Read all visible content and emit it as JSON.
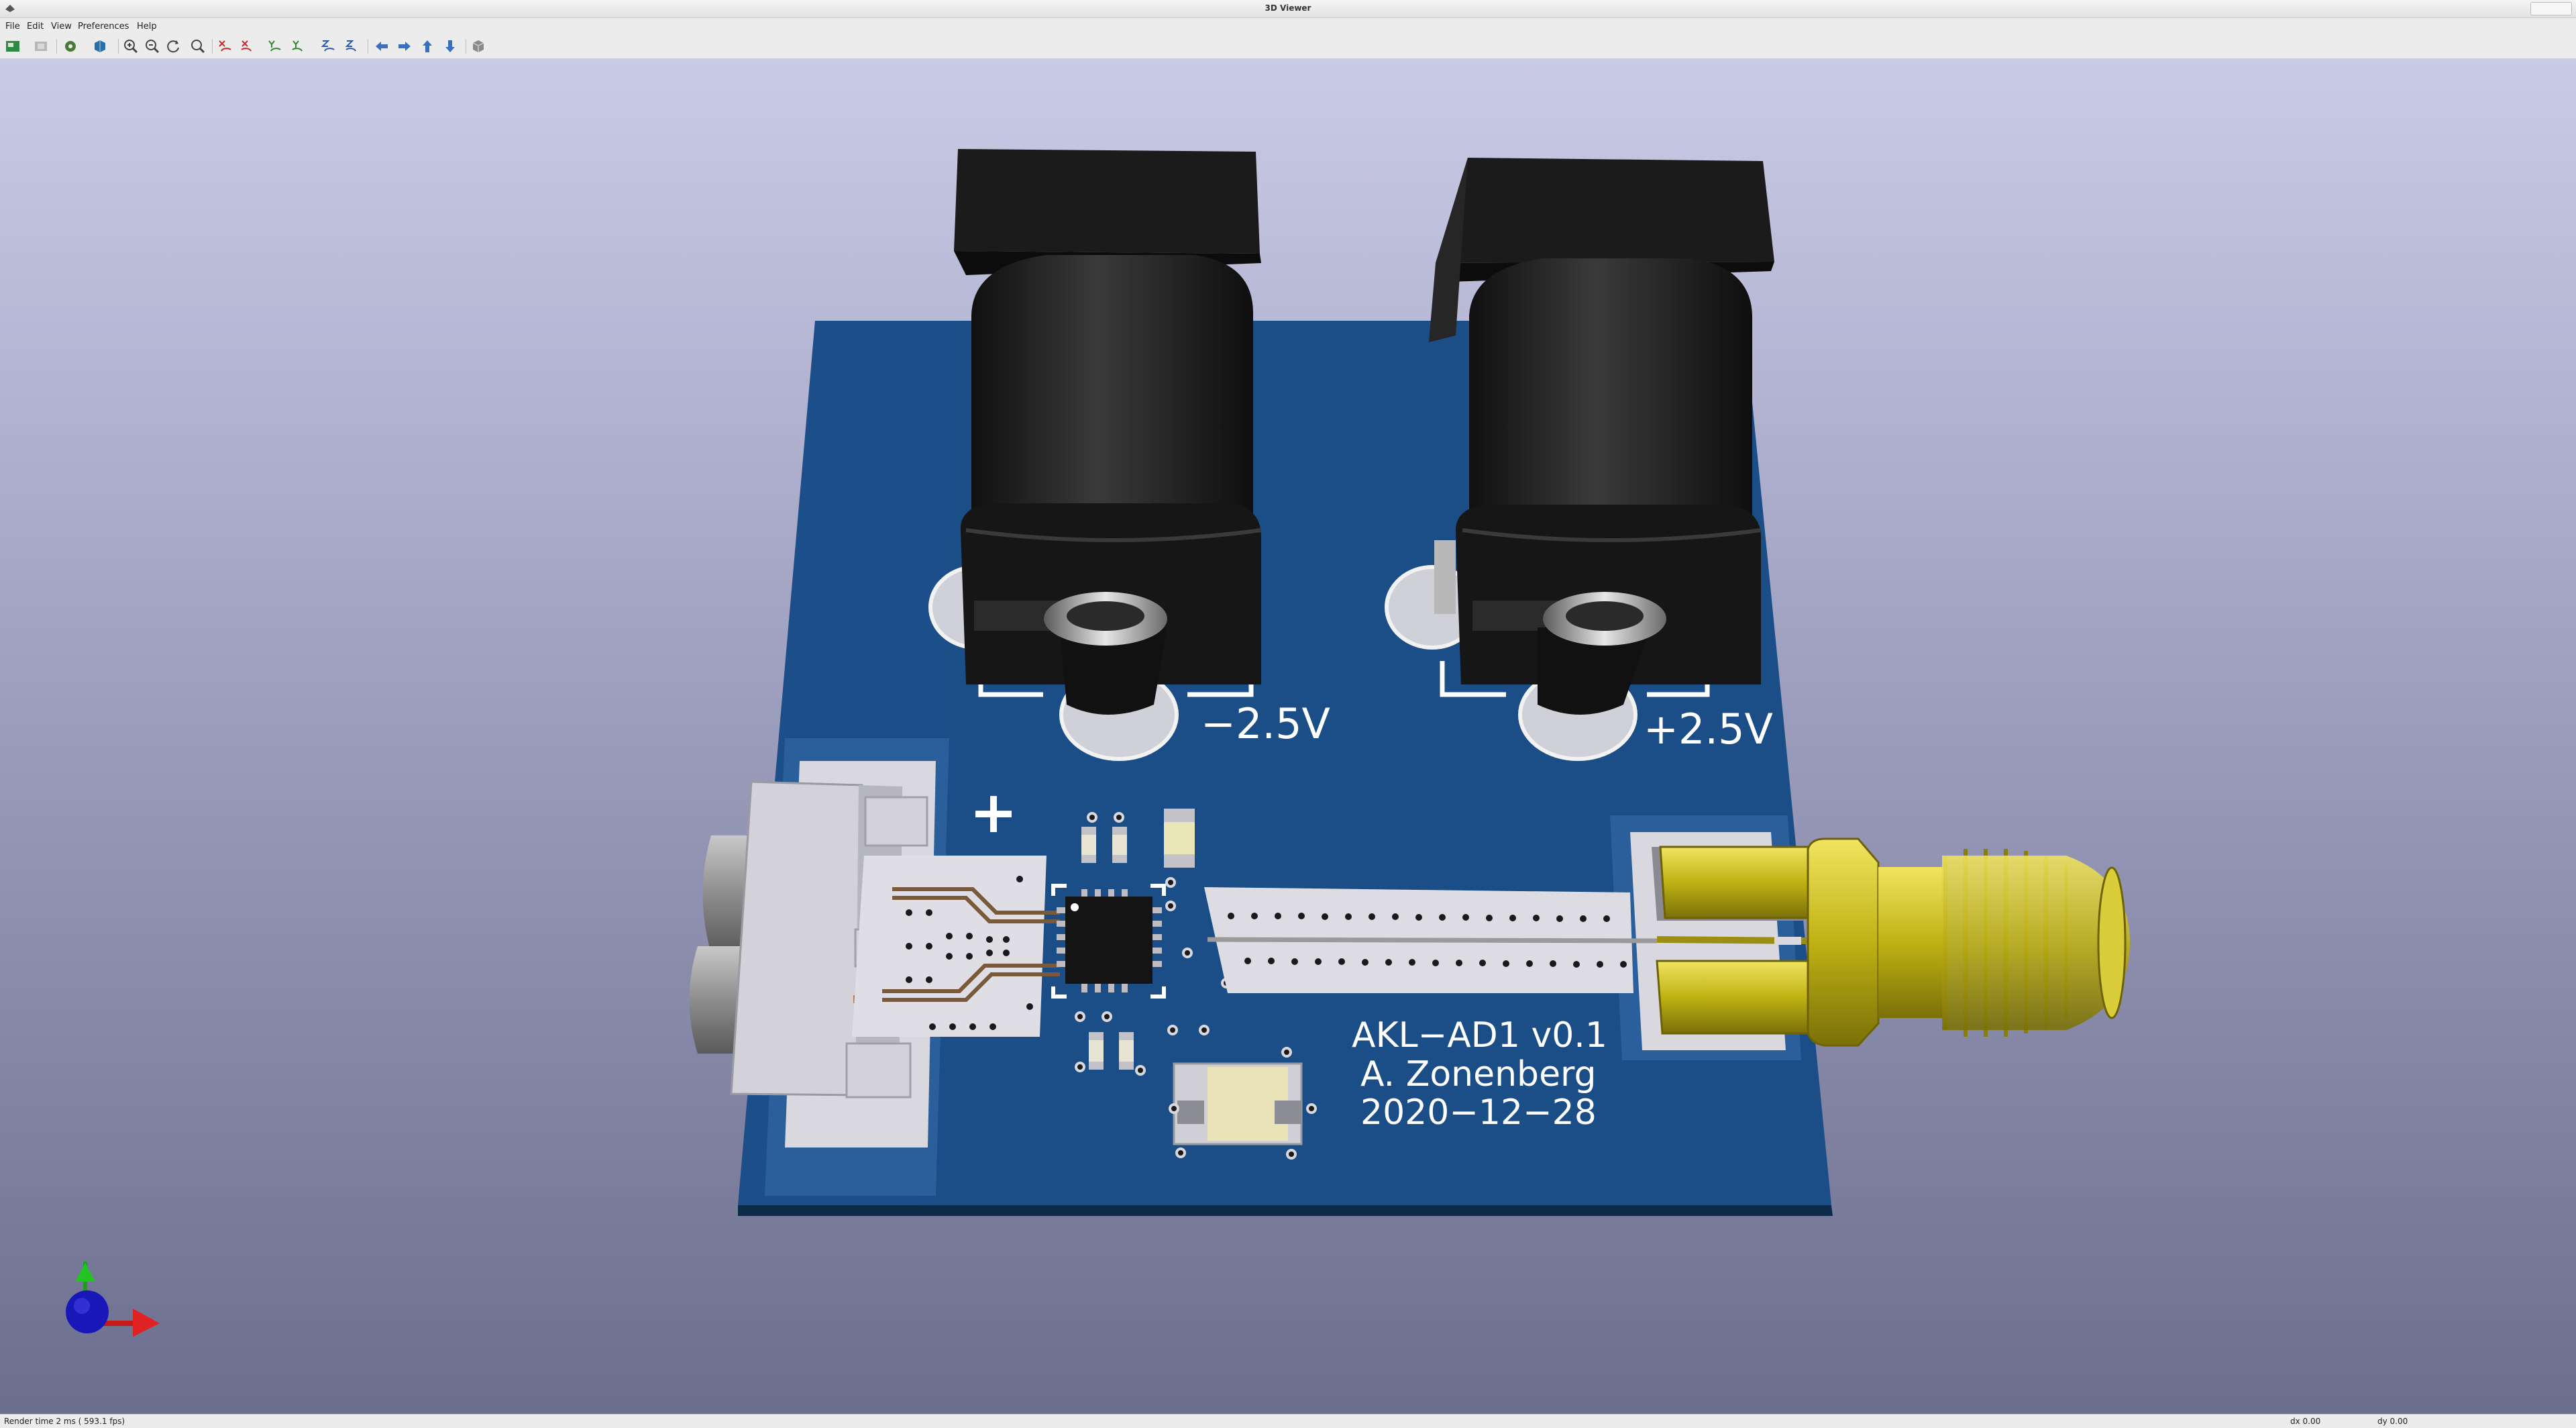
{
  "window": {
    "title": "3D Viewer"
  },
  "menu": {
    "items": [
      "File",
      "Edit",
      "View",
      "Preferences",
      "Help"
    ]
  },
  "toolbar": {
    "icons": [
      "reload-board-icon",
      "copy-image-icon",
      "render-settings-icon",
      "raytrace-icon",
      "zoom-in-icon",
      "zoom-out-icon",
      "zoom-redraw-icon",
      "zoom-fit-icon",
      "rotate-x-cw-icon",
      "rotate-x-ccw-icon",
      "rotate-y-cw-icon",
      "rotate-y-ccw-icon",
      "rotate-z-cw-icon",
      "rotate-z-ccw-icon",
      "move-left-icon",
      "move-right-icon",
      "move-up-icon",
      "move-down-icon",
      "ortho-toggle-icon"
    ]
  },
  "board": {
    "silkscreen": {
      "minus_label": "−2.5V",
      "plus_label": "+2.5V",
      "plus_mark": "+",
      "name": "AKL−AD1 v0.1",
      "author": "A. Zonenberg",
      "date": "2020−12−28"
    },
    "colors": {
      "pcb": "#1b4d86",
      "pad": "#d6d6dc",
      "gold": "#c8ba18",
      "jack": "#1e1e1e",
      "silk": "#ffffff"
    }
  },
  "status": {
    "render": "Render time 2 ms ( 593.1 fps)",
    "dx": "dx 0.00",
    "dy": "dy 0.00"
  }
}
